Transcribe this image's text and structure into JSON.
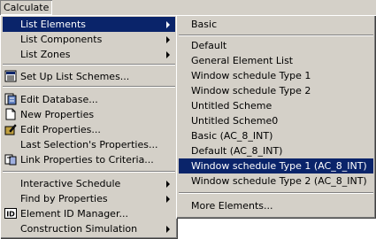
{
  "menubar": {
    "calculate_label": "Calculate"
  },
  "main_menu": {
    "items": [
      {
        "label": "List Elements",
        "has_submenu": true,
        "selected": true
      },
      {
        "label": "List Components",
        "has_submenu": true
      },
      {
        "label": "List Zones",
        "has_submenu": true
      },
      {
        "label": "Set Up List Schemes...",
        "icon": "list-scheme-icon"
      },
      {
        "label": "Edit Database...",
        "icon": "database-icon"
      },
      {
        "label": "New Properties",
        "icon": "new-document-icon"
      },
      {
        "label": "Edit Properties...",
        "icon": "edit-properties-icon"
      },
      {
        "label": "Last Selection's Properties..."
      },
      {
        "label": "Link Properties to Criteria...",
        "icon": "link-properties-icon"
      },
      {
        "label": "Interactive Schedule",
        "has_submenu": true
      },
      {
        "label": "Find by Properties",
        "has_submenu": true
      },
      {
        "label": "Element ID Manager...",
        "icon": "id-icon",
        "icon_text": "ID"
      },
      {
        "label": "Construction Simulation",
        "has_submenu": true
      }
    ]
  },
  "sub_menu": {
    "items": [
      {
        "label": "Basic"
      },
      {
        "label": "Default"
      },
      {
        "label": "General Element List"
      },
      {
        "label": "Window schedule Type 1"
      },
      {
        "label": "Window schedule Type 2"
      },
      {
        "label": "Untitled Scheme"
      },
      {
        "label": "Untitled Scheme0"
      },
      {
        "label": "Basic (AC_8_INT)"
      },
      {
        "label": "Default (AC_8_INT)"
      },
      {
        "label": "Window schedule Type 1 (AC_8_INT)",
        "selected": true
      },
      {
        "label": "Window schedule Type 2 (AC_8_INT)"
      },
      {
        "label": "More Elements..."
      }
    ]
  },
  "colors": {
    "menu_face": "#d4d0c8",
    "highlight": "#0a246a",
    "highlight_text": "#ffffff"
  }
}
